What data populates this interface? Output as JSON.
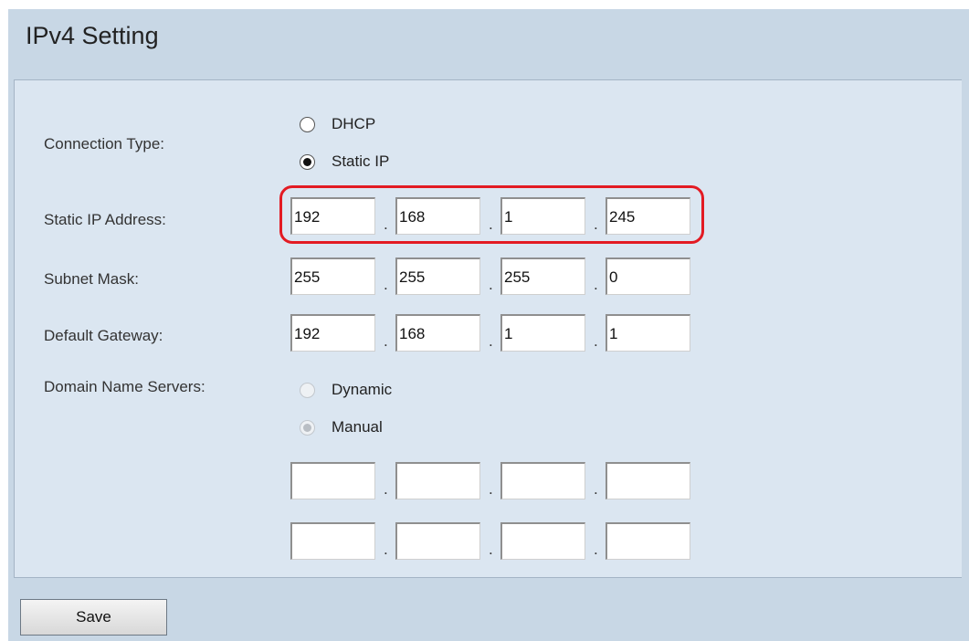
{
  "page": {
    "title": "IPv4 Setting"
  },
  "labels": {
    "connection_type": "Connection Type:",
    "static_ip": "Static IP Address:",
    "subnet_mask": "Subnet Mask:",
    "default_gateway": "Default Gateway:",
    "dns": "Domain Name Servers:"
  },
  "connection_type": {
    "options": [
      "DHCP",
      "Static IP"
    ],
    "selected": "Static IP"
  },
  "static_ip": [
    "192",
    "168",
    "1",
    "245"
  ],
  "subnet_mask": [
    "255",
    "255",
    "255",
    "0"
  ],
  "default_gateway": [
    "192",
    "168",
    "1",
    "1"
  ],
  "dns": {
    "options": [
      "Dynamic",
      "Manual"
    ],
    "selected": "Manual",
    "enabled": false,
    "server1": [
      "",
      "",
      "",
      ""
    ],
    "server2": [
      "",
      "",
      "",
      ""
    ]
  },
  "separator": ".",
  "buttons": {
    "save": "Save"
  },
  "colors": {
    "highlight": "#e31b23",
    "panel": "#dbe6f1",
    "frame": "#c8d7e5"
  }
}
